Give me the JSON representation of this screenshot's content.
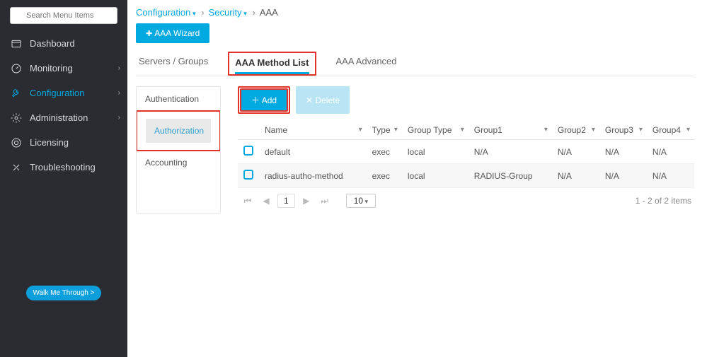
{
  "search": {
    "placeholder": "Search Menu Items"
  },
  "sidebar": {
    "items": [
      {
        "label": "Dashboard"
      },
      {
        "label": "Monitoring",
        "chev": true
      },
      {
        "label": "Configuration",
        "active": true,
        "chev": true
      },
      {
        "label": "Administration",
        "chev": true
      },
      {
        "label": "Licensing"
      },
      {
        "label": "Troubleshooting"
      }
    ],
    "walk_label": "Walk Me Through >"
  },
  "crumbs": {
    "c1": "Configuration",
    "c2": "Security",
    "c3": "AAA",
    "sep": "›"
  },
  "wizard_label": "AAA Wizard",
  "tabs": {
    "t1": "Servers / Groups",
    "t2": "AAA Method List",
    "t3": "AAA Advanced"
  },
  "subtabs": {
    "s1": "Authentication",
    "s2": "Authorization",
    "s3": "Accounting"
  },
  "buttons": {
    "add": "Add",
    "del": "Delete"
  },
  "table": {
    "headers": [
      "Name",
      "Type",
      "Group Type",
      "Group1",
      "Group2",
      "Group3",
      "Group4"
    ],
    "rows": [
      {
        "c": [
          "default",
          "exec",
          "local",
          "N/A",
          "N/A",
          "N/A",
          "N/A"
        ]
      },
      {
        "c": [
          "radius-autho-method",
          "exec",
          "local",
          "RADIUS-Group",
          "N/A",
          "N/A",
          "N/A"
        ]
      }
    ]
  },
  "pager": {
    "page": "1",
    "perpage": "10",
    "status": "1 - 2 of 2 items"
  }
}
